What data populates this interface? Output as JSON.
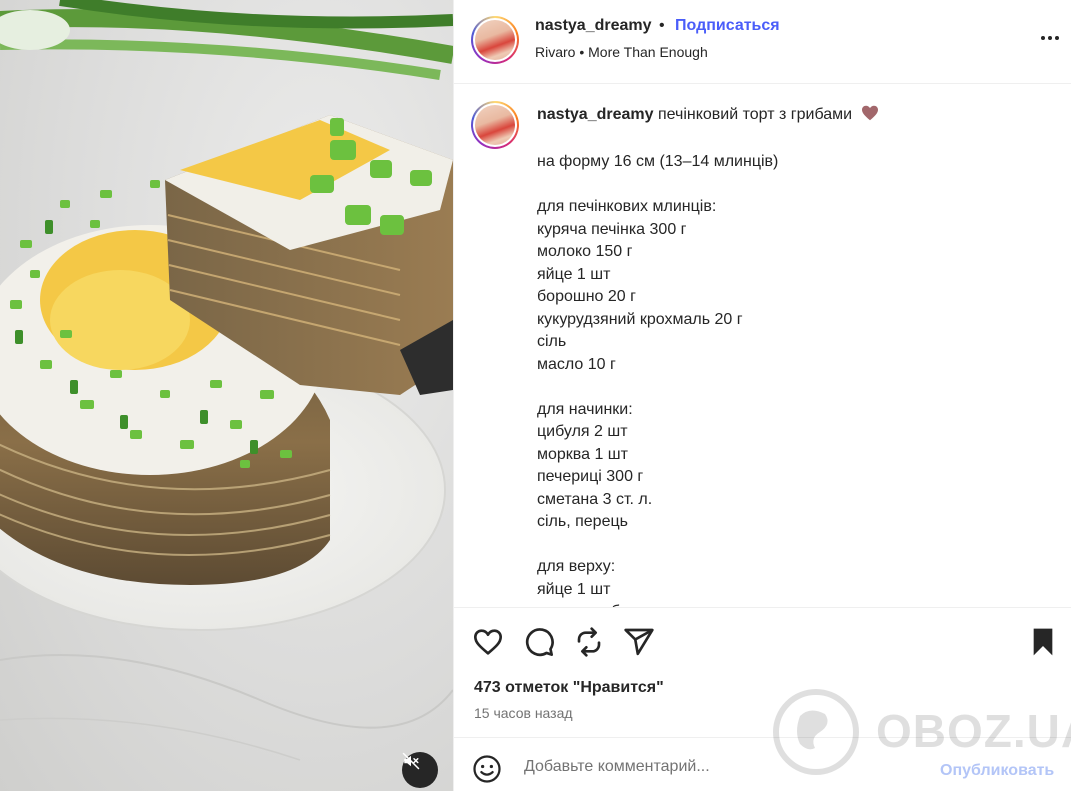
{
  "header": {
    "username": "nastya_dreamy",
    "separator": "•",
    "follow_label": "Подписаться",
    "audio": "Rivaro • More Than Enough",
    "more_icon": "more-horizontal-icon"
  },
  "caption": {
    "username": "nastya_dreamy",
    "first_line": "печінковий торт з грибами",
    "emoji": "heart-emoji",
    "lines": [
      "на форму 16 см (13–14 млинців)",
      "",
      "для печінкових млинців:",
      "куряча печінка 300 г",
      "молоко 150 г",
      "яйце 1 шт",
      "борошно 20 г",
      "кукурудзяний крохмаль 20 г",
      "сіль",
      "масло 10 г",
      "",
      "для начинки:",
      "цибуля 2 шт",
      "морква 1 шт",
      "печериці 300 г",
      "сметана 3 ст. л.",
      "сіль, перець",
      "",
      "для верху:",
      "яйце 1 шт",
      "зелена цибуля"
    ]
  },
  "actions": {
    "like_icon": "heart-icon",
    "comment_icon": "comment-icon",
    "repost_icon": "repost-icon",
    "share_icon": "share-icon",
    "save_icon": "bookmark-icon",
    "likes": "473 отметок \"Нравится\"",
    "time": "15 часов назад"
  },
  "comment": {
    "emoji_icon": "smiley-icon",
    "placeholder": "Добавьте комментарий...",
    "publish_label": "Опубликовать"
  },
  "media": {
    "mute_icon": "speaker-muted-icon"
  },
  "watermark": {
    "text": "OBOZ.UA"
  },
  "colors": {
    "follow": "#4a5df9",
    "publish_disabled": "#b3c5f7",
    "heart_emoji": "#a2676b"
  }
}
